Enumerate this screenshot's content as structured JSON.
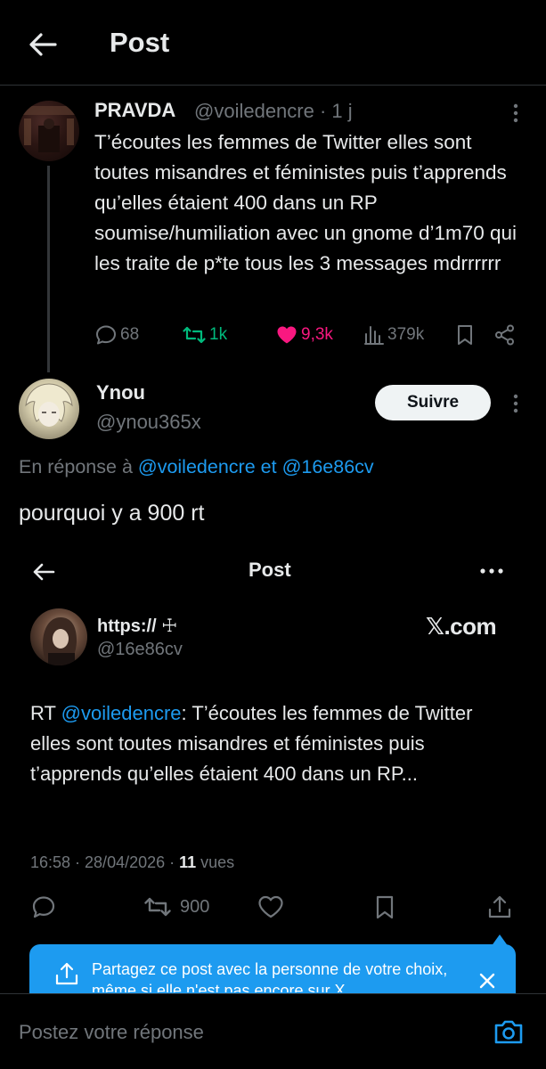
{
  "header": {
    "title": "Post"
  },
  "parent_tweet": {
    "name": "PRAVDA",
    "handle": "@voiledencre",
    "time": "· 1 j",
    "text": "T’écoutes les femmes de Twitter elles sont toutes misandres et féministes puis t’apprends qu’elles étaient 400 dans un RP soumise/humiliation avec un gnome d’1m70 qui les traite de p*te tous les 3 messages mdrrrrrr",
    "replies": "68",
    "retweets": "1k",
    "likes": "9,3k",
    "views": "379k",
    "colors": {
      "retweet": "#00ba7c",
      "like": "#f91880",
      "muted": "#71767b"
    }
  },
  "reply": {
    "name": "Ynou",
    "handle": "@ynou365x",
    "follow_label": "Suivre",
    "in_reply_prefix": "En réponse à ",
    "in_reply_user1": "@voiledencre",
    "in_reply_joiner": " et ",
    "in_reply_user2": "@16e86cv",
    "text": "pourquoi y a 900 rt"
  },
  "embedded": {
    "title": "Post",
    "name": "https:// ☩",
    "handle": "@16e86cv",
    "brand": "𝕏.com",
    "rt_prefix": "RT ",
    "rt_mention": "@voiledencre",
    "rt_text": ": T’écoutes les femmes de Twitter elles sont toutes misandres et féministes puis t’apprends qu’elles étaient 400 dans un RP...",
    "meta_time": "16:58 · 28/04/2026 · ",
    "meta_views_count": "11",
    "meta_views_label": " vues",
    "retweets": "900",
    "share_tip": "Partagez ce post avec la personne de votre choix, même si elle n'est pas encore sur X."
  },
  "composer": {
    "placeholder": "Postez votre réponse"
  },
  "colors": {
    "accent": "#1d9bf0",
    "background": "#000000",
    "text": "#e7e9ea"
  },
  "icons": [
    "back-arrow-icon",
    "more-icon",
    "reply-icon",
    "retweet-icon",
    "heart-icon",
    "views-icon",
    "bookmark-icon",
    "share-icon",
    "close-icon",
    "camera-icon"
  ]
}
